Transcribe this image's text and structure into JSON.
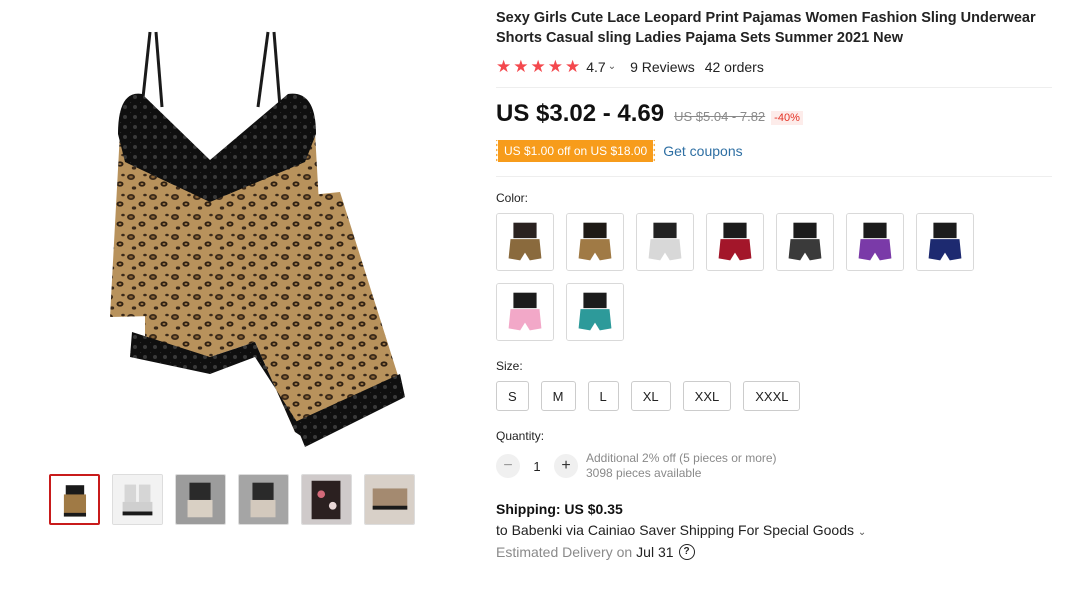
{
  "product": {
    "title": "Sexy Girls Cute Lace Leopard Print Pajamas Women Fashion Sling Underwear Shorts Casual sling Ladies Pajama Sets Summer 2021 New",
    "rating": "4.7",
    "rating_stars": 5,
    "reviews": "9 Reviews",
    "orders": "42 orders"
  },
  "price": {
    "current": "US $3.02 - 4.69",
    "original": "US $5.04 - 7.82",
    "discount": "-40%"
  },
  "coupon": {
    "tag": "US $1.00 off on US $18.00",
    "link": "Get coupons"
  },
  "color": {
    "label": "Color:",
    "options": [
      {
        "name": "leopard-black-strap",
        "top": "#2a2220",
        "bottom": "#8a6a3d"
      },
      {
        "name": "leopard",
        "top": "#1e1a16",
        "bottom": "#a07a45"
      },
      {
        "name": "white-floral",
        "top": "#222222",
        "bottom": "#d8d8d8"
      },
      {
        "name": "red",
        "top": "#1c1c1c",
        "bottom": "#a3162a"
      },
      {
        "name": "black-white",
        "top": "#1c1c1c",
        "bottom": "#3a3a3a"
      },
      {
        "name": "purple",
        "top": "#1c1c1c",
        "bottom": "#7a3aa8"
      },
      {
        "name": "navy",
        "top": "#1c1c1c",
        "bottom": "#1d2a70"
      },
      {
        "name": "pink",
        "top": "#1c1c1c",
        "bottom": "#f2a8c8"
      },
      {
        "name": "teal",
        "top": "#1c1c1c",
        "bottom": "#2d9a9a"
      }
    ]
  },
  "size": {
    "label": "Size:",
    "options": [
      "S",
      "M",
      "L",
      "XL",
      "XXL",
      "XXXL"
    ]
  },
  "quantity": {
    "label": "Quantity:",
    "value": "1",
    "minus": "−",
    "plus": "+",
    "note": "Additional 2% off (5 pieces or more)",
    "available": "3098 pieces available"
  },
  "shipping": {
    "title": "Shipping: US $0.35",
    "detail": "to Babenki via Cainiao Saver Shipping For Special Goods",
    "delivery_label": "Estimated Delivery on",
    "delivery_date": "Jul 31",
    "help": "?"
  },
  "gallery": {
    "thumbs": [
      "leopard-set",
      "white-floral",
      "grey-floral",
      "grey-floral-2",
      "black-floral",
      "floral-shorts"
    ],
    "active": 0
  },
  "colors": {
    "star": "#f4484d",
    "coupon": "#f79c1b",
    "link": "#2e6fa3",
    "discount": "#e43225",
    "active_thumb": "#c81b1b"
  }
}
